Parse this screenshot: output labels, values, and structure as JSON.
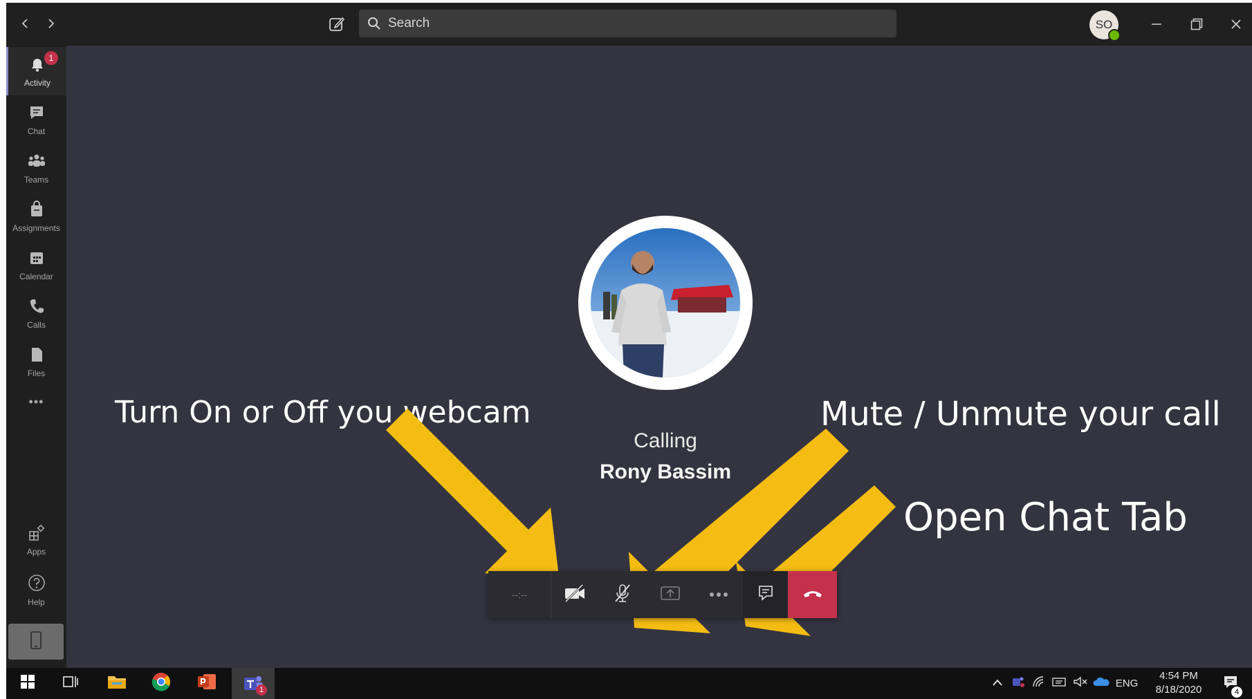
{
  "search": {
    "placeholder": "Search"
  },
  "user": {
    "initials": "SO"
  },
  "rail": {
    "activity_badge": "1",
    "items": [
      {
        "label": "Activity",
        "icon": "bell-icon"
      },
      {
        "label": "Chat",
        "icon": "chat-icon"
      },
      {
        "label": "Teams",
        "icon": "teams-icon"
      },
      {
        "label": "Assignments",
        "icon": "assignments-icon"
      },
      {
        "label": "Calendar",
        "icon": "calendar-icon"
      },
      {
        "label": "Calls",
        "icon": "phone-icon"
      },
      {
        "label": "Files",
        "icon": "files-icon"
      }
    ],
    "more": "•••",
    "apps_label": "Apps",
    "help_label": "Help"
  },
  "call": {
    "status": "Calling",
    "callee": "Rony Bassim",
    "timer": "--:--"
  },
  "annotations": {
    "webcam": "Turn On or Off you webcam",
    "mute": "Mute / Unmute your call",
    "chat": "Open Chat Tab"
  },
  "taskbar": {
    "teams_badge": "1",
    "language": "ENG",
    "time": "4:54 PM",
    "date": "8/18/2020",
    "notification_count": "4"
  },
  "colors": {
    "stage": "#343440",
    "end_call": "#c4314b",
    "arrow": "#f5bd13",
    "accent": "#8b8cc7"
  }
}
